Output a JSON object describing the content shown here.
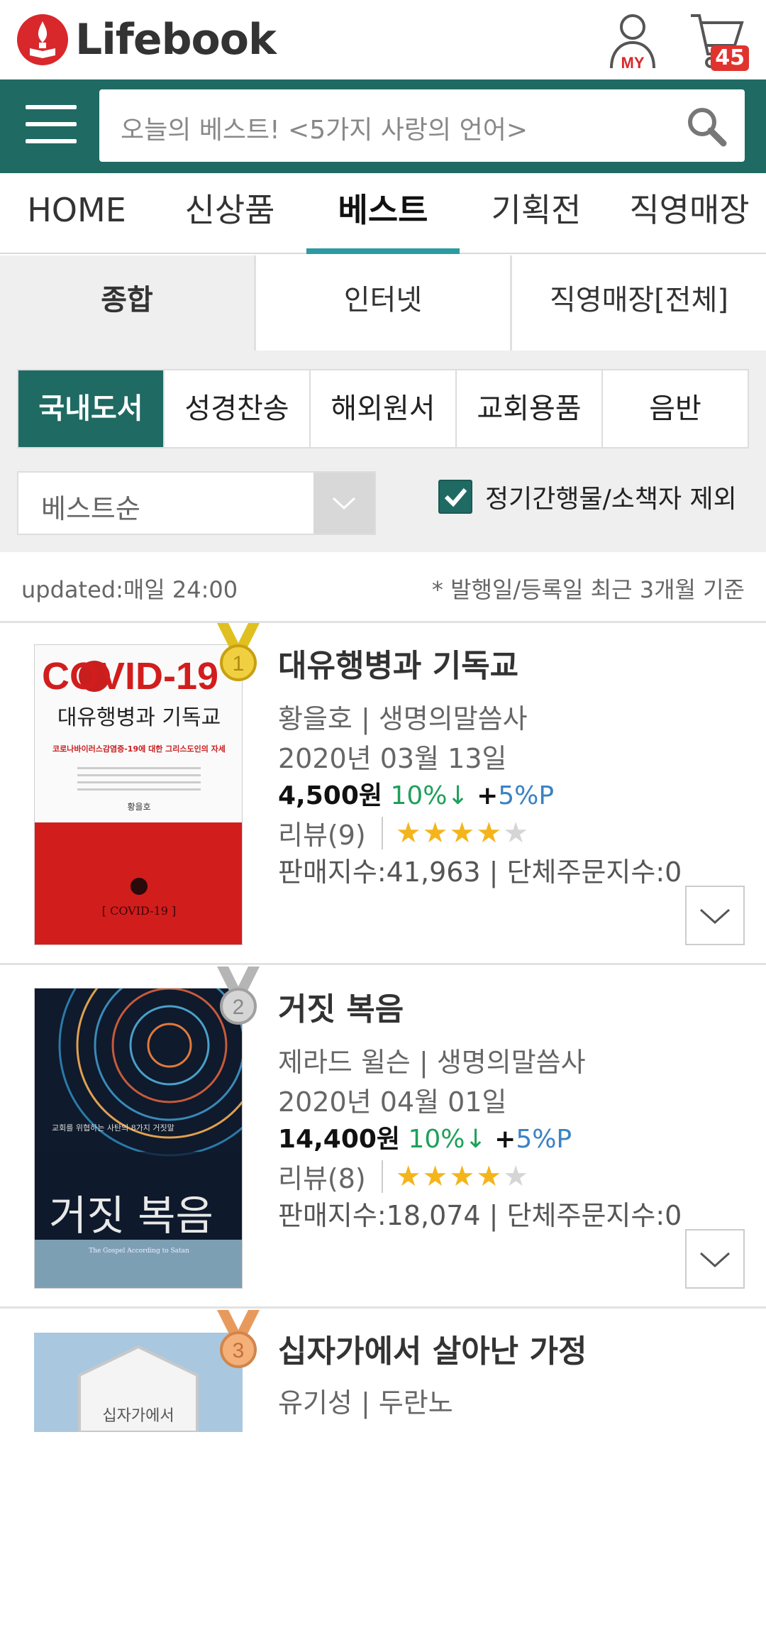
{
  "header": {
    "logo_text": "Lifebook",
    "my_label": "MY",
    "cart_count": "45"
  },
  "search": {
    "placeholder": "오늘의 베스트! <5가지 사랑의 언어>"
  },
  "main_nav": [
    "HOME",
    "신상품",
    "베스트",
    "기획전",
    "직영매장"
  ],
  "sub_tabs": [
    "종합",
    "인터넷",
    "직영매장[전체]"
  ],
  "categories": [
    "국내도서",
    "성경찬송",
    "해외원서",
    "교회용품",
    "음반"
  ],
  "sort": {
    "selected": "베스트순"
  },
  "filter": {
    "exclude_label": "정기간행물/소책자 제외",
    "checked": true
  },
  "info": {
    "updated": "updated:매일 24:00",
    "basis": "* 발행일/등록일 최근 3개월 기준"
  },
  "books": [
    {
      "rank": "1",
      "title": "대유행병과 기독교",
      "author_publisher": "황을호 | 생명의말씀사",
      "date": "2020년 03월 13일",
      "price": "4,500원",
      "discount": "10%↓",
      "point_prefix": "+",
      "point": "5%P",
      "review": "리뷰(9)",
      "rating": 4,
      "sales": "판매지수:41,963 | 단체주문지수:0",
      "cover_title": "COVID-19",
      "cover_subtitle": "대유행병과 기독교",
      "cover_tagline": "코로나바이러스감염증-19에 대한 그리스도인의 자세",
      "cover_author": "황을호",
      "cover_bottom": "[ COVID-19 ]"
    },
    {
      "rank": "2",
      "title": "거짓 복음",
      "author_publisher": "제라드 윌슨 | 생명의말씀사",
      "date": "2020년 04월 01일",
      "price": "14,400원",
      "discount": "10%↓",
      "point_prefix": "+",
      "point": "5%P",
      "review": "리뷰(8)",
      "rating": 4,
      "sales": "판매지수:18,074 | 단체주문지수:0",
      "cover_tagline": "교회를 위협하는 사탄의 8가지 거짓말",
      "cover_title": "거짓 복음",
      "cover_subtitle": "The Gospel According to Satan"
    },
    {
      "rank": "3",
      "title": "십자가에서 살아난 가정",
      "author_publisher": "유기성 | 두란노",
      "cover_title": "십자가에서"
    }
  ]
}
